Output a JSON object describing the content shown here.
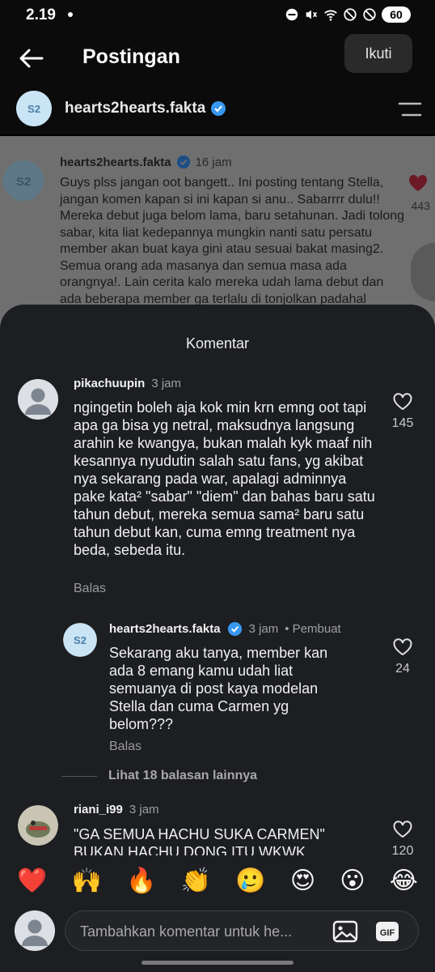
{
  "status": {
    "time": "2.19",
    "battery": "60"
  },
  "header": {
    "title": "Postingan",
    "follow_label": "Ikuti"
  },
  "account": {
    "name": "hearts2hearts.fakta"
  },
  "post": {
    "username": "hearts2hearts.fakta",
    "time": "16 jam",
    "text": "Guys plss jangan oot bangett.. Ini posting tentang Stella, jangan komen kapan si ini kapan si anu.. Sabarrrr dulu!! Mereka debut juga belom lama, baru setahunan. Jadi tolong sabar, kita liat kedepannya mungkin nanti satu persatu member akan buat kaya gini atau sesuai bakat masing2. Semua orang ada masanya dan semua masa ada orangnya!. Lain cerita kalo mereka udah lama debut dan ada beberapa member ga terlalu di tonjolkan padahal",
    "likes": "443"
  },
  "sheet": {
    "title": "Komentar"
  },
  "comments": [
    {
      "username": "pikachuupin",
      "time": "3 jam",
      "text": "ngingetin boleh aja kok min krn emng oot tapi apa ga bisa yg netral, maksudnya langsung arahin ke kwangya, bukan malah kyk maaf nih kesannya nyudutin salah satu fans, yg akibat nya sekarang pada war, apalagi adminnya pake kata² \"sabar\" \"diem\" dan bahas baru satu tahun debut, mereka semua sama² baru satu tahun debut kan, cuma emng treatment nya beda, sebeda itu.",
      "reply_label": "Balas",
      "likes": "145"
    },
    {
      "username": "hearts2hearts.fakta",
      "time": "3 jam",
      "author_tag": "• Pembuat",
      "text": "Sekarang aku tanya, member kan ada 8 emang kamu udah liat semuanya di post kaya modelan Stella dan cuma Carmen yg belom???",
      "reply_label": "Balas",
      "likes": "24"
    },
    {
      "username": "riani_i99",
      "time": "3 jam",
      "text": "\"GA SEMUA HACHU SUKA CARMEN\" BUKAN HACHU DONG ITU WKWK",
      "likes": "120"
    }
  ],
  "more_replies": "Lihat 18 balasan lainnya",
  "emojis": [
    "❤️",
    "🙌",
    "🔥",
    "👏",
    "🥲",
    "😍",
    "😮",
    "😂"
  ],
  "input": {
    "placeholder": "Tambahkan komentar untuk he..."
  },
  "colors": {
    "like_red": "#e0324a",
    "verified_blue": "#3897f0",
    "sheet_bg": "#1c1e21"
  }
}
